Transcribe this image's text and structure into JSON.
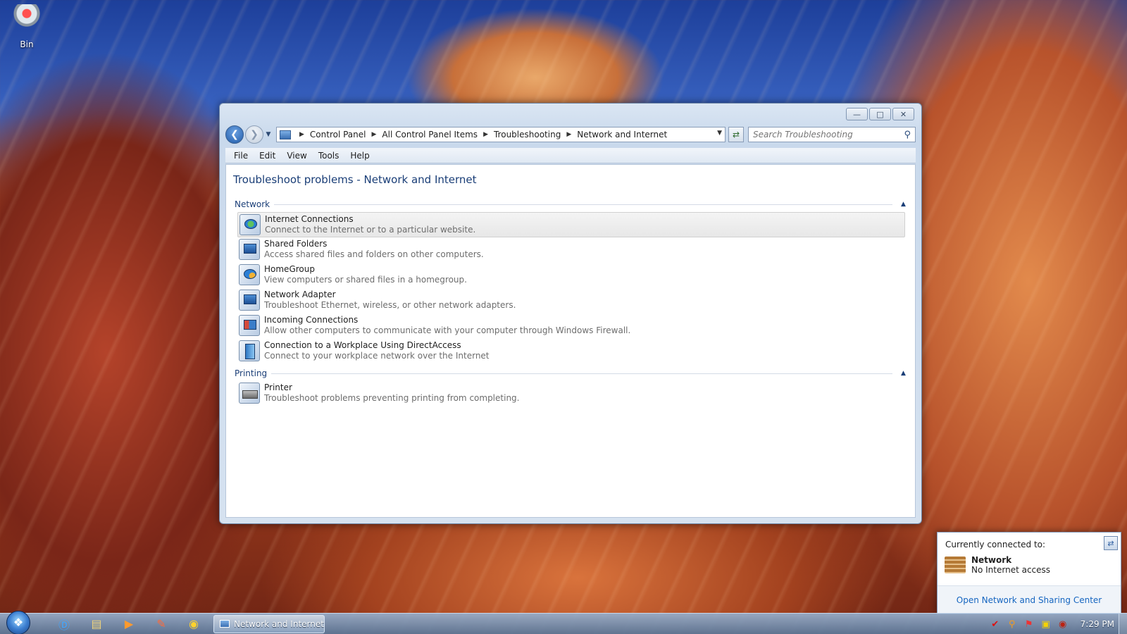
{
  "desktop": {
    "recycle_bin_label": "Bin"
  },
  "window": {
    "breadcrumbs": [
      "Control Panel",
      "All Control Panel Items",
      "Troubleshooting",
      "Network and Internet"
    ],
    "search_placeholder": "Search Troubleshooting",
    "menu": [
      "File",
      "Edit",
      "View",
      "Tools",
      "Help"
    ],
    "page_title": "Troubleshoot problems - Network and Internet",
    "groups": [
      {
        "title": "Network",
        "items": [
          {
            "title": "Internet Connections",
            "desc": "Connect to the Internet or to a particular website.",
            "icon": "internet-connections-icon"
          },
          {
            "title": "Shared Folders",
            "desc": "Access shared files and folders on other computers.",
            "icon": "shared-folders-icon"
          },
          {
            "title": "HomeGroup",
            "desc": "View computers or shared files in a homegroup.",
            "icon": "homegroup-icon"
          },
          {
            "title": "Network Adapter",
            "desc": "Troubleshoot Ethernet, wireless, or other network adapters.",
            "icon": "network-adapter-icon"
          },
          {
            "title": "Incoming Connections",
            "desc": "Allow other computers to communicate with your computer through Windows Firewall.",
            "icon": "incoming-connections-icon"
          },
          {
            "title": "Connection to a Workplace Using DirectAccess",
            "desc": "Connect to your workplace network over the Internet",
            "icon": "directaccess-icon"
          }
        ]
      },
      {
        "title": "Printing",
        "items": [
          {
            "title": "Printer",
            "desc": "Troubleshoot problems preventing printing from completing.",
            "icon": "printer-icon"
          }
        ]
      }
    ]
  },
  "flyout": {
    "header": "Currently connected to:",
    "network_name": "Network",
    "network_status": "No Internet access",
    "link": "Open Network and Sharing Center"
  },
  "taskbar": {
    "task_label": "Network and Internet",
    "clock": "7:29 PM"
  }
}
